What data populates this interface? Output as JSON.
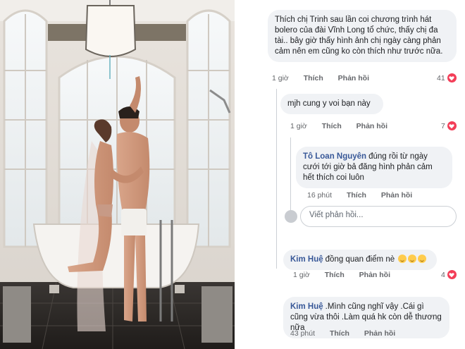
{
  "comments": [
    {
      "text": "Thích chị Trinh sau lần coi chương trình hát bolero của đài Vĩnh Long tổ chức, thấy chị đa tài.. bây giờ thấy hình ảnh chị ngày càng phản cảm nên em cũng ko còn thích như trước nữa.",
      "time": "1 giờ",
      "like": "Thích",
      "reply": "Phản hồi",
      "reactions": "41"
    },
    {
      "text": "mjh cung y voi bạn này",
      "time": "1 giờ",
      "like": "Thích",
      "reply": "Phản hồi",
      "reactions": "7"
    },
    {
      "author": "Tô Loan Nguyên",
      "text": "đúng rồi từ ngày cưới tới giờ bả đăng hình phản cảm hết thích coi luôn",
      "time": "16 phút",
      "like": "Thích",
      "reply": "Phản hồi"
    },
    {
      "author": "Kim Huệ",
      "text": "đồng quan điểm nè",
      "time": "1 giờ",
      "like": "Thích",
      "reply": "Phản hồi",
      "reactions": "4"
    },
    {
      "author": "Kim Huệ",
      "text": ".Mình cũng nghĩ vậy .Cái gì cũng vừa thôi .Làm quá hk còn dễ thương nữa",
      "time": "43 phút",
      "like": "Thích",
      "reply": "Phản hồi"
    }
  ],
  "reply_input": {
    "placeholder": "Viết phản hồi..."
  },
  "colors": {
    "bubble": "#f0f2f5",
    "author": "#385898",
    "meta": "#65676b",
    "heart": "#f33e58"
  }
}
